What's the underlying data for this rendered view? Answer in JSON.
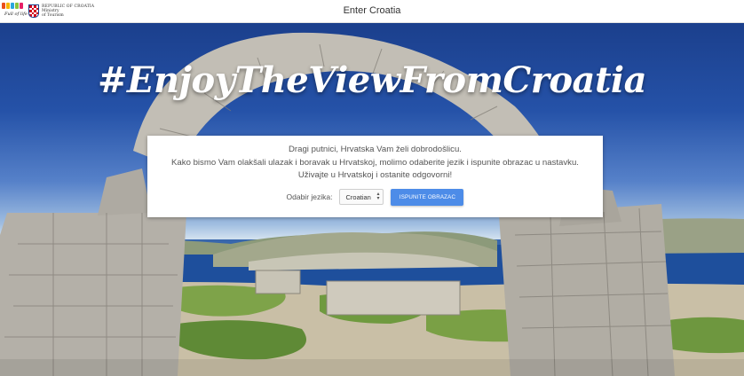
{
  "header": {
    "logo_script": "Full of life",
    "ministry_line1": "REPUBLIC OF CROATIA",
    "ministry_line2": "Ministry",
    "ministry_line3": "of Tourism",
    "title": "Enter Croatia"
  },
  "hero": {
    "headline": "#EnjoyTheViewFromCroatia"
  },
  "panel": {
    "line1": "Dragi putnici, Hrvatska Vam želi dobrodošlicu.",
    "line2": "Kako bismo Vam olakšali ulazak i boravak u Hrvatskoj, molimo odaberite jezik i ispunite obrazac u nastavku.",
    "line3": "Uživajte u Hrvatskoj i ostanite odgovorni!",
    "language_label": "Odabir jezika:",
    "language_selected": "Croatian",
    "button_label": "ISPUNITE OBRAZAC"
  },
  "colors": {
    "button": "#4d8ce8",
    "sky_top": "#1b3f8c",
    "sea": "#1e4f9c"
  },
  "icons": {
    "select_chevron": "chevron-updown-icon",
    "crest": "croatian-checkerboard-crest-icon"
  }
}
